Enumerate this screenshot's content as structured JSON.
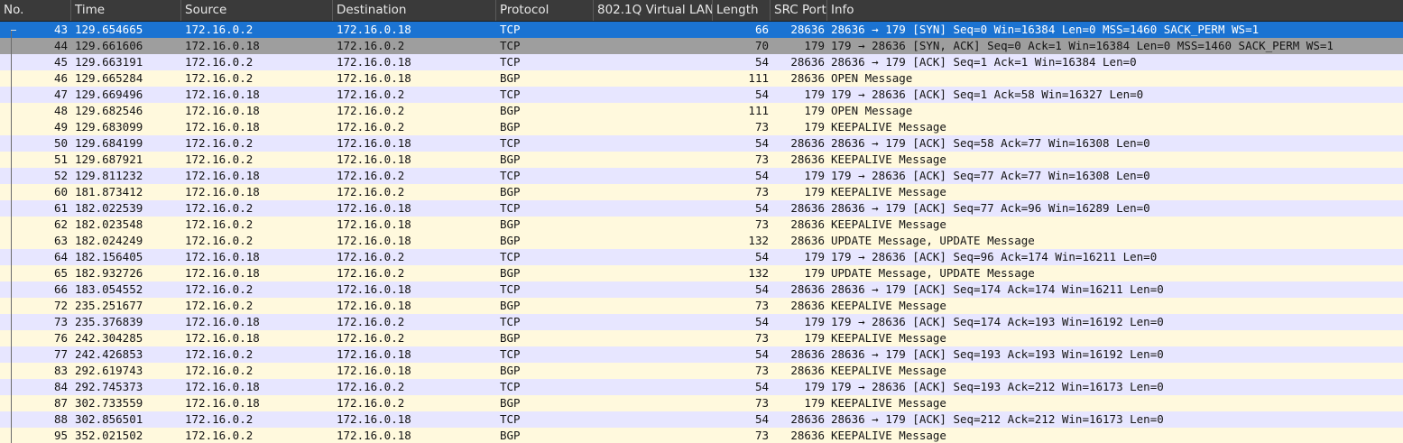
{
  "columns": [
    {
      "key": "no",
      "label": "No."
    },
    {
      "key": "time",
      "label": "Time"
    },
    {
      "key": "source",
      "label": "Source"
    },
    {
      "key": "destination",
      "label": "Destination"
    },
    {
      "key": "protocol",
      "label": "Protocol"
    },
    {
      "key": "vlan",
      "label": "802.1Q Virtual LAN"
    },
    {
      "key": "length",
      "label": "Length"
    },
    {
      "key": "src_port",
      "label": "SRC Port"
    },
    {
      "key": "info",
      "label": "Info"
    }
  ],
  "colors": {
    "tcp_row": "#e7e6ff",
    "bgp_row": "#fff9dd",
    "selected_row": "#1b73d2",
    "related_row": "#9e9e9e",
    "header_bg": "#3a3a3a"
  },
  "rows": [
    {
      "no": "43",
      "time": "129.654665",
      "source": "172.16.0.2",
      "destination": "172.16.0.18",
      "protocol": "TCP",
      "vlan": "",
      "length": "66",
      "src_port": "28636",
      "info": "28636 → 179 [SYN] Seq=0 Win=16384 Len=0 MSS=1460 SACK_PERM WS=1",
      "state": "selected"
    },
    {
      "no": "44",
      "time": "129.661606",
      "source": "172.16.0.18",
      "destination": "172.16.0.2",
      "protocol": "TCP",
      "vlan": "",
      "length": "70",
      "src_port": "179",
      "info": "179 → 28636 [SYN, ACK] Seq=0 Ack=1 Win=16384 Len=0 MSS=1460 SACK_PERM WS=1",
      "state": "related"
    },
    {
      "no": "45",
      "time": "129.663191",
      "source": "172.16.0.2",
      "destination": "172.16.0.18",
      "protocol": "TCP",
      "vlan": "",
      "length": "54",
      "src_port": "28636",
      "info": "28636 → 179 [ACK] Seq=1 Ack=1 Win=16384 Len=0",
      "state": ""
    },
    {
      "no": "46",
      "time": "129.665284",
      "source": "172.16.0.2",
      "destination": "172.16.0.18",
      "protocol": "BGP",
      "vlan": "",
      "length": "111",
      "src_port": "28636",
      "info": "OPEN Message",
      "state": ""
    },
    {
      "no": "47",
      "time": "129.669496",
      "source": "172.16.0.18",
      "destination": "172.16.0.2",
      "protocol": "TCP",
      "vlan": "",
      "length": "54",
      "src_port": "179",
      "info": "179 → 28636 [ACK] Seq=1 Ack=58 Win=16327 Len=0",
      "state": ""
    },
    {
      "no": "48",
      "time": "129.682546",
      "source": "172.16.0.18",
      "destination": "172.16.0.2",
      "protocol": "BGP",
      "vlan": "",
      "length": "111",
      "src_port": "179",
      "info": "OPEN Message",
      "state": ""
    },
    {
      "no": "49",
      "time": "129.683099",
      "source": "172.16.0.18",
      "destination": "172.16.0.2",
      "protocol": "BGP",
      "vlan": "",
      "length": "73",
      "src_port": "179",
      "info": "KEEPALIVE Message",
      "state": ""
    },
    {
      "no": "50",
      "time": "129.684199",
      "source": "172.16.0.2",
      "destination": "172.16.0.18",
      "protocol": "TCP",
      "vlan": "",
      "length": "54",
      "src_port": "28636",
      "info": "28636 → 179 [ACK] Seq=58 Ack=77 Win=16308 Len=0",
      "state": ""
    },
    {
      "no": "51",
      "time": "129.687921",
      "source": "172.16.0.2",
      "destination": "172.16.0.18",
      "protocol": "BGP",
      "vlan": "",
      "length": "73",
      "src_port": "28636",
      "info": "KEEPALIVE Message",
      "state": ""
    },
    {
      "no": "52",
      "time": "129.811232",
      "source": "172.16.0.18",
      "destination": "172.16.0.2",
      "protocol": "TCP",
      "vlan": "",
      "length": "54",
      "src_port": "179",
      "info": "179 → 28636 [ACK] Seq=77 Ack=77 Win=16308 Len=0",
      "state": ""
    },
    {
      "no": "60",
      "time": "181.873412",
      "source": "172.16.0.18",
      "destination": "172.16.0.2",
      "protocol": "BGP",
      "vlan": "",
      "length": "73",
      "src_port": "179",
      "info": "KEEPALIVE Message",
      "state": ""
    },
    {
      "no": "61",
      "time": "182.022539",
      "source": "172.16.0.2",
      "destination": "172.16.0.18",
      "protocol": "TCP",
      "vlan": "",
      "length": "54",
      "src_port": "28636",
      "info": "28636 → 179 [ACK] Seq=77 Ack=96 Win=16289 Len=0",
      "state": ""
    },
    {
      "no": "62",
      "time": "182.023548",
      "source": "172.16.0.2",
      "destination": "172.16.0.18",
      "protocol": "BGP",
      "vlan": "",
      "length": "73",
      "src_port": "28636",
      "info": "KEEPALIVE Message",
      "state": ""
    },
    {
      "no": "63",
      "time": "182.024249",
      "source": "172.16.0.2",
      "destination": "172.16.0.18",
      "protocol": "BGP",
      "vlan": "",
      "length": "132",
      "src_port": "28636",
      "info": "UPDATE Message, UPDATE Message",
      "state": ""
    },
    {
      "no": "64",
      "time": "182.156405",
      "source": "172.16.0.18",
      "destination": "172.16.0.2",
      "protocol": "TCP",
      "vlan": "",
      "length": "54",
      "src_port": "179",
      "info": "179 → 28636 [ACK] Seq=96 Ack=174 Win=16211 Len=0",
      "state": ""
    },
    {
      "no": "65",
      "time": "182.932726",
      "source": "172.16.0.18",
      "destination": "172.16.0.2",
      "protocol": "BGP",
      "vlan": "",
      "length": "132",
      "src_port": "179",
      "info": "UPDATE Message, UPDATE Message",
      "state": ""
    },
    {
      "no": "66",
      "time": "183.054552",
      "source": "172.16.0.2",
      "destination": "172.16.0.18",
      "protocol": "TCP",
      "vlan": "",
      "length": "54",
      "src_port": "28636",
      "info": "28636 → 179 [ACK] Seq=174 Ack=174 Win=16211 Len=0",
      "state": ""
    },
    {
      "no": "72",
      "time": "235.251677",
      "source": "172.16.0.2",
      "destination": "172.16.0.18",
      "protocol": "BGP",
      "vlan": "",
      "length": "73",
      "src_port": "28636",
      "info": "KEEPALIVE Message",
      "state": ""
    },
    {
      "no": "73",
      "time": "235.376839",
      "source": "172.16.0.18",
      "destination": "172.16.0.2",
      "protocol": "TCP",
      "vlan": "",
      "length": "54",
      "src_port": "179",
      "info": "179 → 28636 [ACK] Seq=174 Ack=193 Win=16192 Len=0",
      "state": ""
    },
    {
      "no": "76",
      "time": "242.304285",
      "source": "172.16.0.18",
      "destination": "172.16.0.2",
      "protocol": "BGP",
      "vlan": "",
      "length": "73",
      "src_port": "179",
      "info": "KEEPALIVE Message",
      "state": ""
    },
    {
      "no": "77",
      "time": "242.426853",
      "source": "172.16.0.2",
      "destination": "172.16.0.18",
      "protocol": "TCP",
      "vlan": "",
      "length": "54",
      "src_port": "28636",
      "info": "28636 → 179 [ACK] Seq=193 Ack=193 Win=16192 Len=0",
      "state": ""
    },
    {
      "no": "83",
      "time": "292.619743",
      "source": "172.16.0.2",
      "destination": "172.16.0.18",
      "protocol": "BGP",
      "vlan": "",
      "length": "73",
      "src_port": "28636",
      "info": "KEEPALIVE Message",
      "state": ""
    },
    {
      "no": "84",
      "time": "292.745373",
      "source": "172.16.0.18",
      "destination": "172.16.0.2",
      "protocol": "TCP",
      "vlan": "",
      "length": "54",
      "src_port": "179",
      "info": "179 → 28636 [ACK] Seq=193 Ack=212 Win=16173 Len=0",
      "state": ""
    },
    {
      "no": "87",
      "time": "302.733559",
      "source": "172.16.0.18",
      "destination": "172.16.0.2",
      "protocol": "BGP",
      "vlan": "",
      "length": "73",
      "src_port": "179",
      "info": "KEEPALIVE Message",
      "state": ""
    },
    {
      "no": "88",
      "time": "302.856501",
      "source": "172.16.0.2",
      "destination": "172.16.0.18",
      "protocol": "TCP",
      "vlan": "",
      "length": "54",
      "src_port": "28636",
      "info": "28636 → 179 [ACK] Seq=212 Ack=212 Win=16173 Len=0",
      "state": ""
    },
    {
      "no": "95",
      "time": "352.021502",
      "source": "172.16.0.2",
      "destination": "172.16.0.18",
      "protocol": "BGP",
      "vlan": "",
      "length": "73",
      "src_port": "28636",
      "info": "KEEPALIVE Message",
      "state": ""
    }
  ]
}
